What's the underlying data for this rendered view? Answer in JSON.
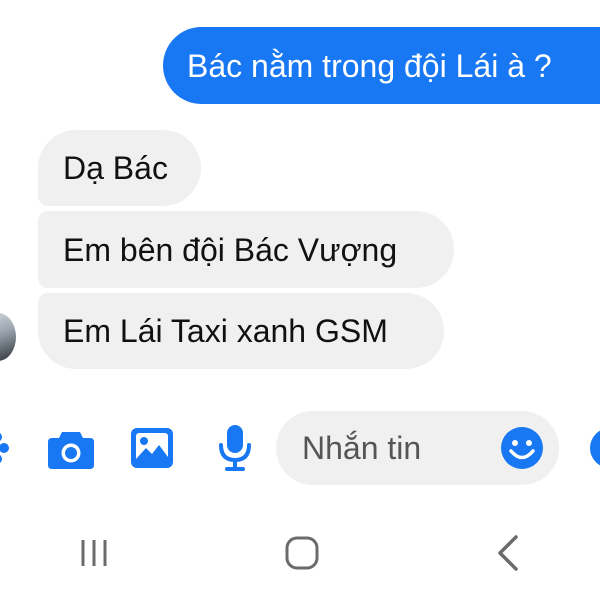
{
  "conversation": {
    "outgoing": [
      {
        "text": "Bác nằm trong đội Lái à ?"
      }
    ],
    "incoming": [
      {
        "text": "Dạ Bác"
      },
      {
        "text": "Em bên đội Bác Vượng"
      },
      {
        "text": "Em Lái Taxi xanh GSM"
      }
    ]
  },
  "composer": {
    "placeholder": "Nhắn tin",
    "value": "",
    "icons": [
      "more-actions-icon",
      "camera-icon",
      "gallery-icon",
      "microphone-icon",
      "emoji-icon",
      "send-like-icon"
    ]
  },
  "navigation_bar": {
    "icons": [
      "recent-apps-icon",
      "home-icon",
      "back-icon"
    ]
  },
  "colors": {
    "outgoing_bubble": "#1877f2",
    "incoming_bubble": "#f0f0f1",
    "accent_icon": "#1877f2",
    "nav_icon": "#6b6b6b"
  }
}
